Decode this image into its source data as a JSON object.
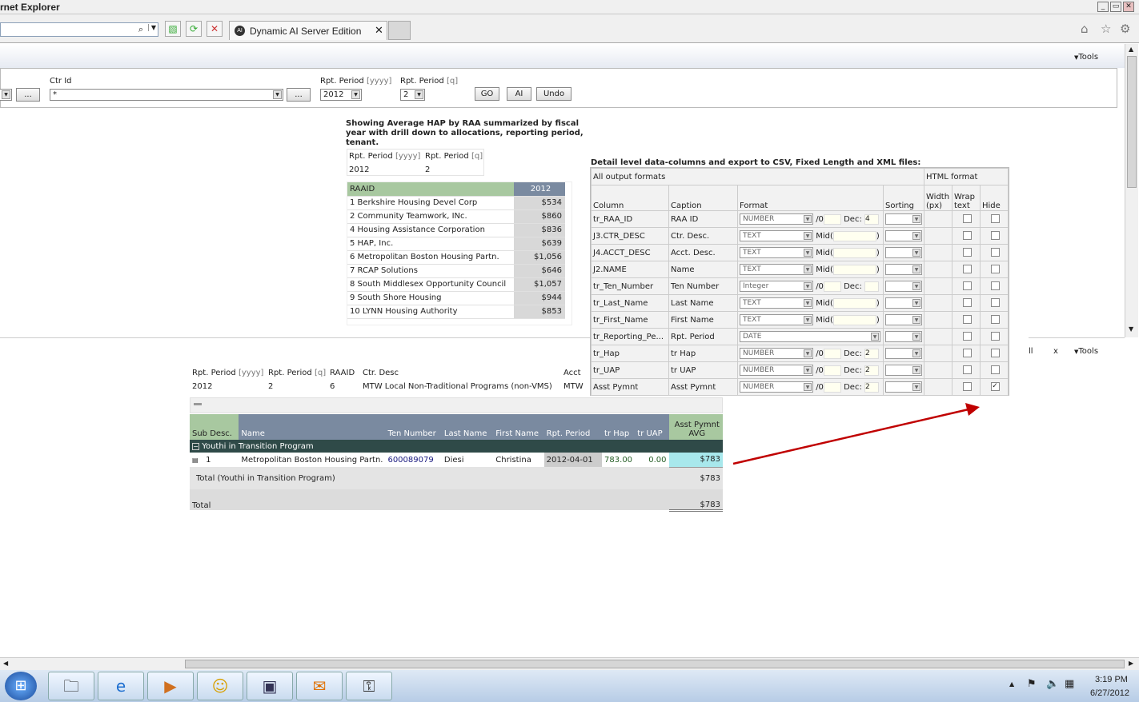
{
  "window": {
    "title": "rnet Explorer"
  },
  "browser": {
    "tab_label": "Dynamic AI Server Edition",
    "search_icon": "search-icon"
  },
  "toolbar": {
    "tools_label": "Tools"
  },
  "params": {
    "ctr_label": "Ctr Id",
    "ctr_value": "*",
    "period_yyyy_label": "Rpt. Period",
    "period_yyyy_unit": "[yyyy]",
    "period_yyyy_value": "2012",
    "period_q_label": "Rpt. Period",
    "period_q_unit": "[q]",
    "period_q_value": "2",
    "go": "GO",
    "ai": "AI",
    "undo": "Undo",
    "more": "...",
    "more2": "..."
  },
  "summary": {
    "heading": "Showing Average HAP by RAA summarized by fiscal year with drill down to allocations, reporting period, tenant.",
    "col1": "Rpt. Period",
    "col1u": "[yyyy]",
    "col2": "Rpt. Period",
    "col2u": "[q]",
    "v1": "2012",
    "v2": "2",
    "raaid_header": "RAAID",
    "year_header": "2012",
    "rows": [
      {
        "name": "1 Berkshire Housing Devel Corp",
        "amt": "$534"
      },
      {
        "name": "2 Community Teamwork, INc.",
        "amt": "$860"
      },
      {
        "name": "4 Housing Assistance Corporation",
        "amt": "$836"
      },
      {
        "name": "5 HAP, Inc.",
        "amt": "$639"
      },
      {
        "name": "6 Metropolitan Boston Housing Partn.",
        "amt": "$1,056"
      },
      {
        "name": "7 RCAP Solutions",
        "amt": "$646"
      },
      {
        "name": "8 South Middlesex Opportunity Council",
        "amt": "$1,057"
      },
      {
        "name": "9 South Shore Housing",
        "amt": "$944"
      },
      {
        "name": "10 LYNN Housing Authority",
        "amt": "$853"
      }
    ]
  },
  "detail": {
    "heading": "Detail level data-columns and export to CSV, Fixed Length and XML files:",
    "all_formats": "All output formats",
    "html_format": "HTML format",
    "h_column": "Column",
    "h_caption": "Caption",
    "h_format": "Format",
    "h_sorting": "Sorting",
    "h_width": "Width (px)",
    "h_wrap": "Wrap text",
    "h_hide": "Hide",
    "rows": [
      {
        "col": "tr_RAA_ID",
        "cap": "RAA ID",
        "fmt": "NUMBER",
        "kind": "num",
        "dec": "4",
        "hide": false
      },
      {
        "col": "J3.CTR_DESC",
        "cap": "Ctr. Desc.",
        "fmt": "TEXT",
        "kind": "text",
        "dec": "",
        "hide": false
      },
      {
        "col": "J4.ACCT_DESC",
        "cap": "Acct. Desc.",
        "fmt": "TEXT",
        "kind": "text",
        "dec": "",
        "hide": false
      },
      {
        "col": "J2.NAME",
        "cap": "Name",
        "fmt": "TEXT",
        "kind": "text",
        "dec": "",
        "hide": false
      },
      {
        "col": "tr_Ten_Number",
        "cap": "Ten Number",
        "fmt": "Integer",
        "kind": "num",
        "dec": "",
        "hide": false
      },
      {
        "col": "tr_Last_Name",
        "cap": "Last Name",
        "fmt": "TEXT",
        "kind": "text",
        "dec": "",
        "hide": false
      },
      {
        "col": "tr_First_Name",
        "cap": "First Name",
        "fmt": "TEXT",
        "kind": "text",
        "dec": "",
        "hide": false
      },
      {
        "col": "tr_Reporting_Pe...",
        "cap": "Rpt. Period",
        "fmt": "DATE",
        "kind": "date",
        "dec": "",
        "hide": false
      },
      {
        "col": "tr_Hap",
        "cap": "tr Hap",
        "fmt": "NUMBER",
        "kind": "num",
        "dec": "2",
        "hide": false
      },
      {
        "col": "tr_UAP",
        "cap": "tr UAP",
        "fmt": "NUMBER",
        "kind": "num",
        "dec": "2",
        "hide": false
      },
      {
        "col": "Asst Pymnt",
        "cap": "Asst Pymnt",
        "fmt": "NUMBER",
        "kind": "num",
        "dec": "2",
        "hide": true
      }
    ],
    "slash0": "/0",
    "dec_label": "Dec:",
    "mid_label": "Mid("
  },
  "drill": {
    "p_yyyy": "Rpt. Period",
    "p_yyyy_u": "[yyyy]",
    "p_q": "Rpt. Period",
    "p_q_u": "[q]",
    "raaid": "RAAID",
    "ctr_desc": "Ctr. Desc",
    "acct": "Acct",
    "v_yyyy": "2012",
    "v_q": "2",
    "v_raaid": "6",
    "v_ctr": "MTW Local Non-Traditional Programs (non-VMS)",
    "v_acct": "MTW",
    "cols": [
      "Sub Desc.",
      "Name",
      "Ten Number",
      "Last Name",
      "First Name",
      "Rpt. Period",
      "tr Hap",
      "tr UAP",
      "Asst Pymnt AVG"
    ],
    "group": "Youthi in Transition Program",
    "row": {
      "num": "1",
      "name": "Metropolitan Boston Housing Partn.",
      "ten": "600089079",
      "last": "Diesi",
      "first": "Christina",
      "period": "2012-04-01",
      "hap": "783.00",
      "uap": "0.00",
      "amt": "$783"
    },
    "subtotal_label": "Total (Youthi in Transition Program)",
    "subtotal": "$783",
    "total_label": "Total",
    "total": "$783",
    "right_tools": "Tools",
    "right_all": "ll",
    "right_x": "x"
  },
  "taskbar": {
    "time": "3:19 PM",
    "date": "6/27/2012"
  }
}
